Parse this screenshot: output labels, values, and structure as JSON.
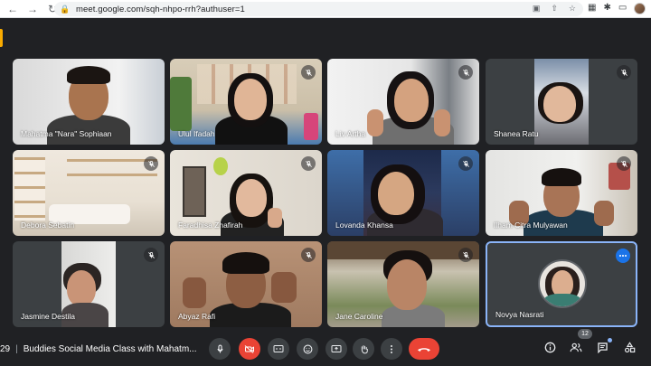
{
  "browser": {
    "url": "meet.google.com/sqh-nhpo-rrh?authuser=1"
  },
  "participants": [
    {
      "name": "Mahatma \"Nara\" Sophiaan",
      "muted": false
    },
    {
      "name": "Ulul Ifadah",
      "muted": true
    },
    {
      "name": "Liv Artha",
      "muted": true
    },
    {
      "name": "Shanea Ratu",
      "muted": true
    },
    {
      "name": "Debora Sebatin",
      "muted": true
    },
    {
      "name": "Faradhisa Zhafirah",
      "muted": true
    },
    {
      "name": "Lovanda Khansa",
      "muted": true
    },
    {
      "name": "Ilham Citra Mulyawan",
      "muted": true
    },
    {
      "name": "Jasmine Destila",
      "muted": true
    },
    {
      "name": "Abyaz Rafi",
      "muted": true
    },
    {
      "name": "Jane Caroline",
      "muted": true
    },
    {
      "name": "Novya Nasrati",
      "muted": false
    }
  ],
  "footer": {
    "time": "29",
    "separator": "|",
    "meeting_title": "Buddies Social Media Class with Mahatm...",
    "participant_count": "12"
  },
  "colors": {
    "accent": "#8ab4f8",
    "hangup": "#ea4335",
    "active_speaker": "#1a73e8"
  }
}
